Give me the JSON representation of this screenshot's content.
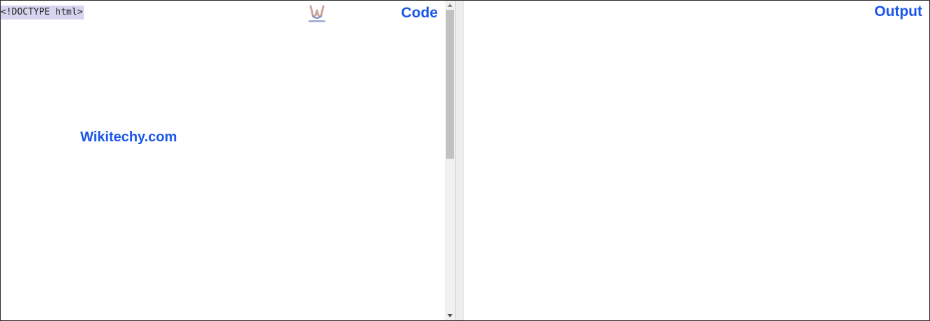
{
  "code_panel": {
    "label": "Code",
    "first_line": "<!DOCTYPE html>",
    "watermark": "Wikitechy.com",
    "logo_icon": "wikitechy-logo-icon"
  },
  "output_panel": {
    "label": "Output"
  },
  "colors": {
    "accent": "#1a56e8",
    "selection": "#d6d4ee",
    "scroll_thumb": "#c1c1c1"
  }
}
